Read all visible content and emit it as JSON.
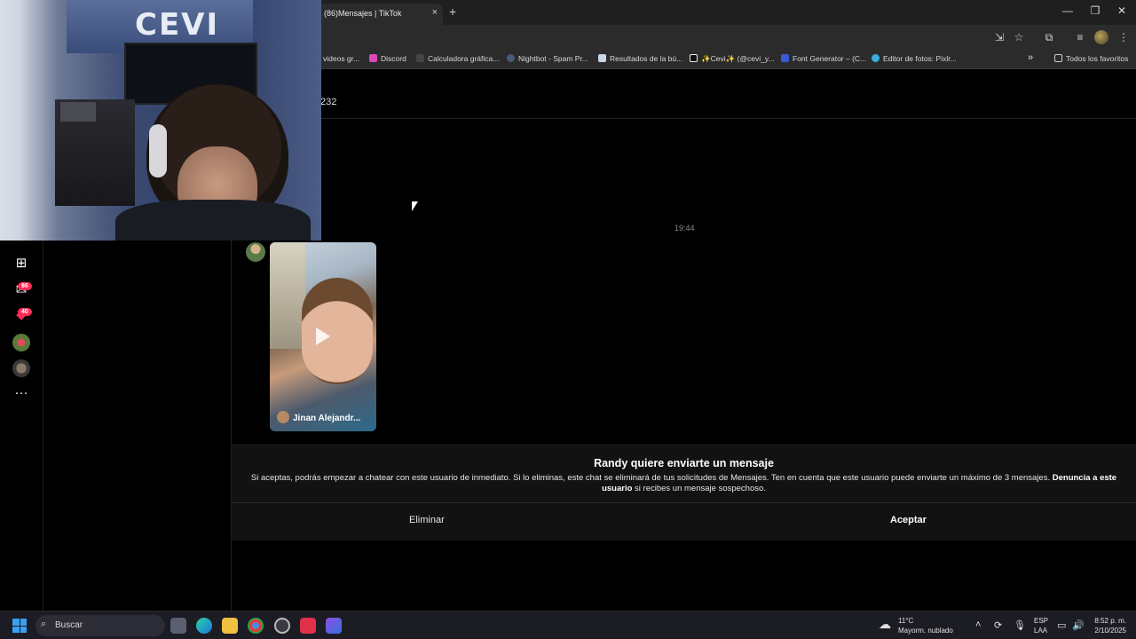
{
  "browser": {
    "tab_title": "(86)Mensajes | TikTok",
    "tab_close": "×",
    "new_tab": "+",
    "window_controls": [
      "—",
      "❐",
      "✕"
    ],
    "bookmarks": [
      {
        "label": "videos gr...",
        "icon": "folder-icon"
      },
      {
        "label": "Discord",
        "icon": "discord-icon"
      },
      {
        "label": "Calculadora gráfica...",
        "icon": "desmos-icon"
      },
      {
        "label": "Nightbot - Spam Pr...",
        "icon": "nightbot-icon"
      },
      {
        "label": "Resultados de la bú...",
        "icon": "search-result-icon"
      },
      {
        "label": "✨Cevi✨ (@cevi_y...",
        "icon": "tiktok-icon"
      },
      {
        "label": "Font Generator – (C...",
        "icon": "font-icon"
      },
      {
        "label": "Editor de fotos: Pixlr...",
        "icon": "pixlr-icon"
      }
    ],
    "bookmarks_overflow": "»",
    "all_favorites": "Todos los favoritos"
  },
  "sidebar": {
    "items": [
      {
        "name": "upload-icon",
        "glyph": "⊞"
      },
      {
        "name": "messages-icon",
        "glyph": "✉",
        "badge": "86"
      },
      {
        "name": "activity-icon",
        "glyph": "◆",
        "badge": "40"
      },
      {
        "name": "profile-avatar",
        "glyph": ""
      },
      {
        "name": "secondary-avatar",
        "glyph": ""
      },
      {
        "name": "more-icon",
        "glyph": "···"
      }
    ]
  },
  "chat": {
    "header_partial": "232",
    "timestamp": "19:44",
    "video_author": "Jinan Alejandr..."
  },
  "request": {
    "title": "Randy quiere enviarte un mensaje",
    "body": "Si aceptas, podrás empezar a chatear con este usuario de inmediato. Si lo eliminas, este chat se eliminará de tus solicitudes de Mensajes. Ten en cuenta que este usuario puede enviarte un máximo de 3 mensajes.",
    "report_link": "Denuncia a este usuario",
    "body_suffix": " si recibes un mensaje sospechoso.",
    "delete_label": "Eliminar",
    "accept_label": "Aceptar"
  },
  "webcam": {
    "wall_text": "CEVI"
  },
  "taskbar": {
    "search_placeholder": "Buscar",
    "weather_temp": "11°C",
    "weather_desc": "Mayorm. nublado",
    "lang_line1": "ESP",
    "lang_line2": "LAA",
    "time": "8:52 p. m.",
    "date": "2/10/2025"
  },
  "colors": {
    "accent": "#fe2c55",
    "background": "#000000",
    "panel": "#121212"
  }
}
